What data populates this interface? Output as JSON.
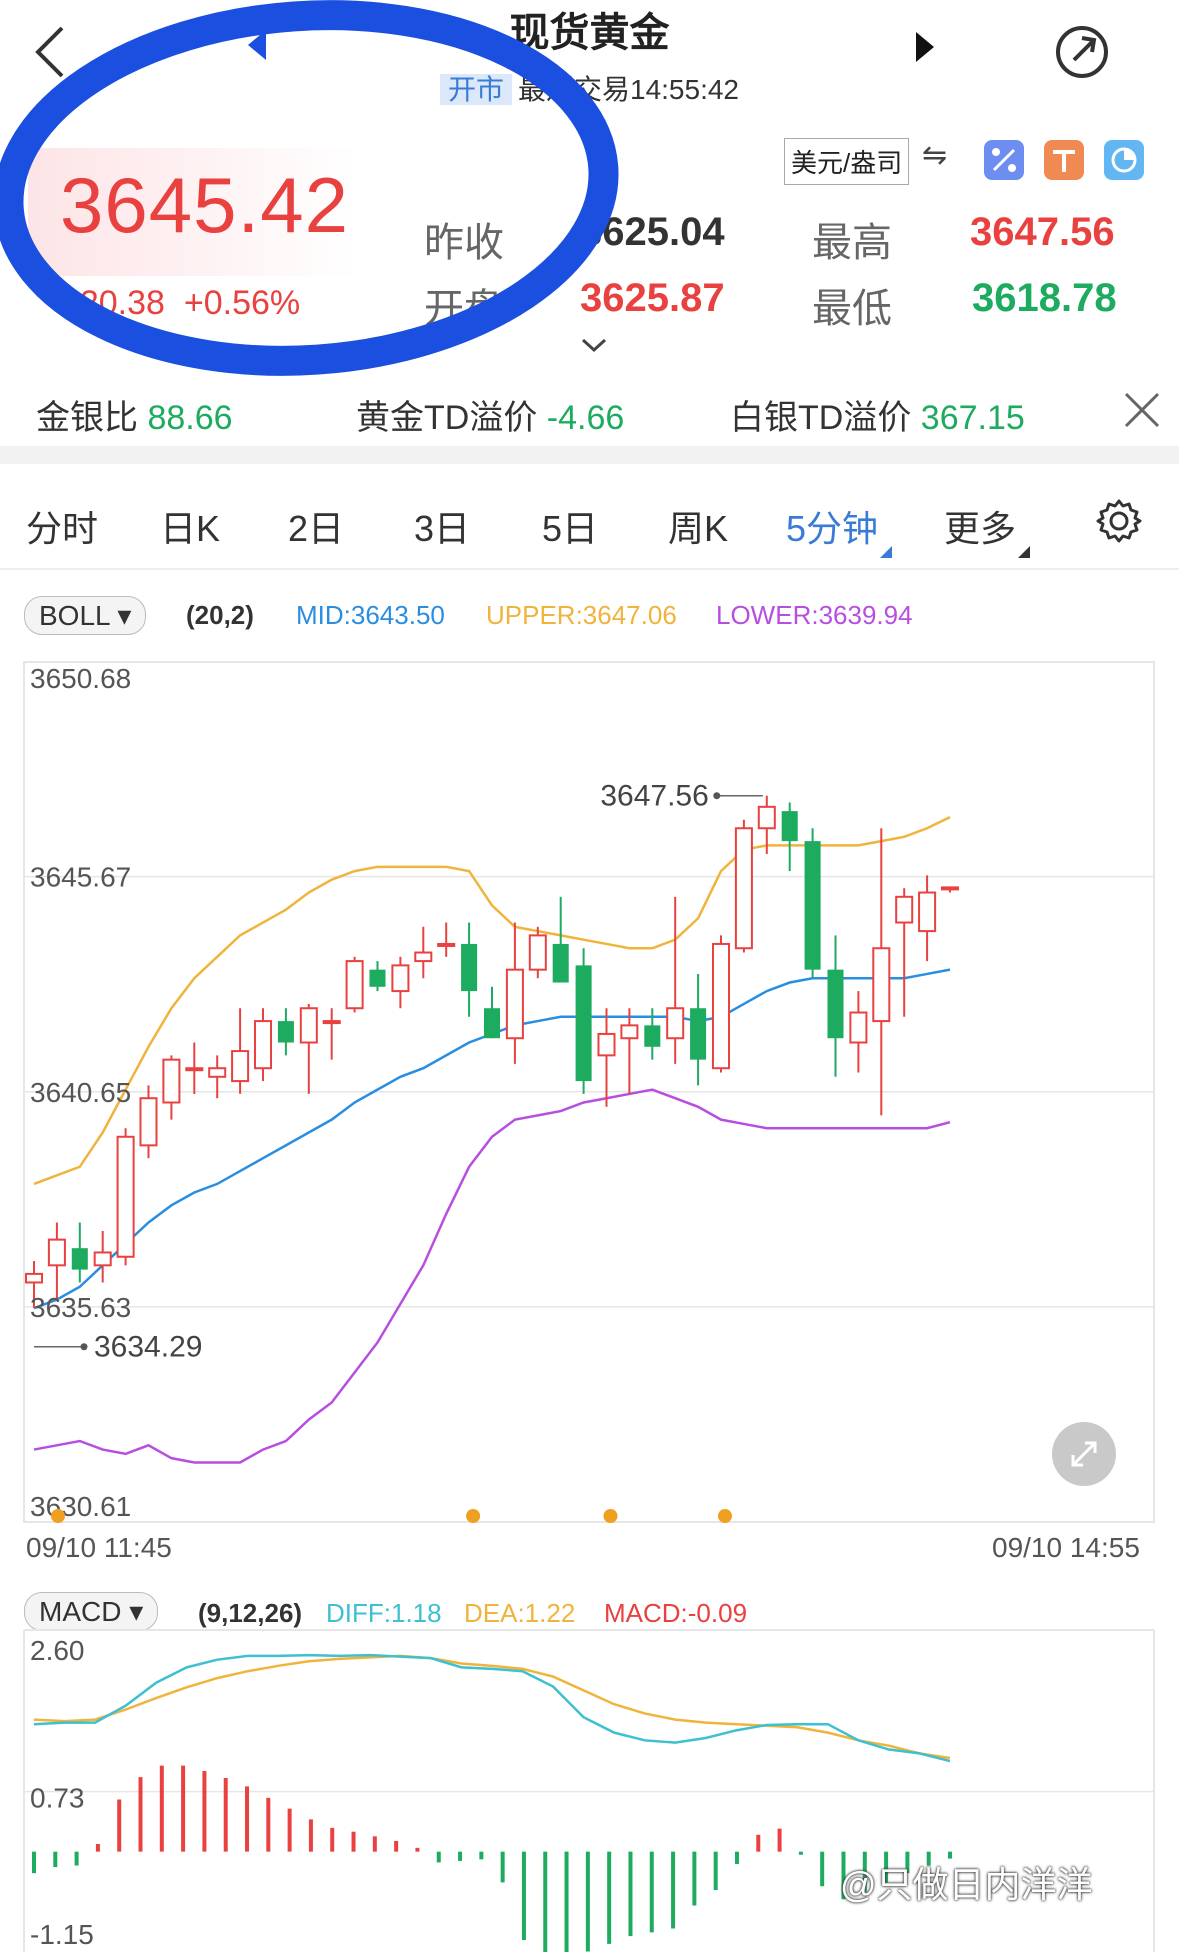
{
  "header": {
    "title": "现货黄金",
    "status_badge": "开市",
    "last_trade": "最近交易14:55:42"
  },
  "quote": {
    "price": "3645.42",
    "change": "+20.38",
    "change_pct": "+0.56%",
    "unit": "美元/盎司",
    "prev_close_label": "昨收",
    "prev_close": "3625.04",
    "open_label": "开盘",
    "open": "3625.87",
    "high_label": "最高",
    "high": "3647.56",
    "low_label": "最低",
    "low": "3618.78"
  },
  "ratio_bar": {
    "gs_label": "金银比",
    "gs_value": "88.66",
    "gold_td_label": "黄金TD溢价",
    "gold_td_value": "-4.66",
    "silver_td_label": "白银TD溢价",
    "silver_td_value": "367.15"
  },
  "tabs": [
    {
      "label": "分时"
    },
    {
      "label": "日K"
    },
    {
      "label": "2日"
    },
    {
      "label": "3日"
    },
    {
      "label": "5日"
    },
    {
      "label": "周K"
    },
    {
      "label": "5分钟"
    },
    {
      "label": "更多"
    }
  ],
  "boll": {
    "name": "BOLL",
    "params": "(20,2)",
    "mid": "MID:3643.50",
    "upper": "UPPER:3647.06",
    "lower": "LOWER:3639.94"
  },
  "macd": {
    "name": "MACD",
    "params": "(9,12,26)",
    "diff": "DIFF:1.18",
    "dea": "DEA:1.22",
    "macd": "MACD:-0.09"
  },
  "time_axis": {
    "start": "09/10 11:45",
    "end": "09/10 14:55"
  },
  "watermark": "@只做日内洋洋",
  "colors": {
    "up": "#e8413f",
    "down": "#1dab5f",
    "mid": "#2a8ee0",
    "upper": "#f0b43c",
    "lower": "#b84ee0",
    "accent": "#3a7bd5",
    "circle": "#1a4fe0"
  },
  "chart_data": [
    {
      "type": "candlestick",
      "title": "",
      "ylim": [
        3630.61,
        3650.68
      ],
      "yticks": [
        "3650.68",
        "3645.67",
        "3640.65",
        "3635.63",
        "3630.61"
      ],
      "max_label": "3647.56",
      "min_label": "3634.29",
      "candles": [
        [
          3636.2,
          3636.7,
          3635.6,
          3636.4
        ],
        [
          3636.6,
          3637.6,
          3635.8,
          3637.2
        ],
        [
          3637.0,
          3637.6,
          3636.2,
          3636.5
        ],
        [
          3636.6,
          3637.4,
          3636.2,
          3636.9
        ],
        [
          3636.8,
          3639.8,
          3636.6,
          3639.6
        ],
        [
          3639.4,
          3640.8,
          3639.1,
          3640.5
        ],
        [
          3640.4,
          3641.5,
          3640.0,
          3641.4
        ],
        [
          3641.2,
          3641.8,
          3640.6,
          3641.2
        ],
        [
          3641.0,
          3641.5,
          3640.5,
          3641.2
        ],
        [
          3640.9,
          3642.6,
          3640.6,
          3641.6
        ],
        [
          3641.2,
          3642.6,
          3640.9,
          3642.3
        ],
        [
          3642.3,
          3642.6,
          3641.5,
          3641.8
        ],
        [
          3641.8,
          3642.7,
          3640.6,
          3642.6
        ],
        [
          3642.3,
          3642.6,
          3641.4,
          3642.3
        ],
        [
          3642.6,
          3643.8,
          3642.5,
          3643.7
        ],
        [
          3643.5,
          3643.7,
          3643.0,
          3643.1
        ],
        [
          3643.0,
          3643.8,
          3642.6,
          3643.6
        ],
        [
          3643.7,
          3644.5,
          3643.3,
          3643.9
        ],
        [
          3644.1,
          3644.6,
          3643.8,
          3644.1
        ],
        [
          3644.1,
          3644.6,
          3642.4,
          3643.0
        ],
        [
          3642.6,
          3643.1,
          3641.9,
          3641.9
        ],
        [
          3641.9,
          3644.6,
          3641.3,
          3643.5
        ],
        [
          3643.5,
          3644.5,
          3643.3,
          3644.3
        ],
        [
          3644.1,
          3645.2,
          3643.9,
          3643.2
        ],
        [
          3643.6,
          3644.0,
          3640.6,
          3640.9
        ],
        [
          3641.5,
          3642.6,
          3640.3,
          3642.0
        ],
        [
          3641.9,
          3642.6,
          3640.6,
          3642.2
        ],
        [
          3642.2,
          3642.6,
          3641.4,
          3641.7
        ],
        [
          3641.9,
          3645.2,
          3641.3,
          3642.6
        ],
        [
          3642.6,
          3643.4,
          3640.8,
          3641.4
        ],
        [
          3641.2,
          3644.3,
          3641.1,
          3644.1
        ],
        [
          3644.0,
          3647.0,
          3643.9,
          3646.8
        ],
        [
          3646.8,
          3647.56,
          3646.2,
          3647.3
        ],
        [
          3647.2,
          3647.4,
          3645.8,
          3646.5
        ],
        [
          3646.5,
          3646.8,
          3643.3,
          3643.5
        ],
        [
          3643.5,
          3644.3,
          3641.0,
          3641.9
        ],
        [
          3641.8,
          3643.0,
          3641.1,
          3642.5
        ],
        [
          3642.3,
          3646.8,
          3640.1,
          3644.0
        ],
        [
          3644.6,
          3645.4,
          3642.4,
          3645.2
        ],
        [
          3644.4,
          3645.7,
          3643.7,
          3645.3
        ],
        [
          3645.4,
          3645.4,
          3645.3,
          3645.42
        ]
      ],
      "mid": [
        3635.6,
        3635.8,
        3636.1,
        3636.6,
        3637.1,
        3637.6,
        3638.0,
        3638.3,
        3638.5,
        3638.8,
        3639.1,
        3639.4,
        3639.7,
        3640.0,
        3640.4,
        3640.7,
        3641.0,
        3641.2,
        3641.5,
        3641.8,
        3642.0,
        3642.2,
        3642.3,
        3642.4,
        3642.4,
        3642.4,
        3642.4,
        3642.4,
        3642.4,
        3642.3,
        3642.4,
        3642.7,
        3643.0,
        3643.2,
        3643.3,
        3643.3,
        3643.3,
        3643.3,
        3643.3,
        3643.4,
        3643.5
      ],
      "upper": [
        3638.5,
        3638.7,
        3638.9,
        3639.7,
        3640.7,
        3641.7,
        3642.6,
        3643.3,
        3643.8,
        3644.3,
        3644.6,
        3644.9,
        3645.3,
        3645.6,
        3645.8,
        3645.9,
        3645.9,
        3645.9,
        3645.9,
        3645.8,
        3645.0,
        3644.5,
        3644.4,
        3644.3,
        3644.2,
        3644.1,
        3644.0,
        3644.0,
        3644.2,
        3644.7,
        3645.8,
        3646.3,
        3646.4,
        3646.4,
        3646.4,
        3646.4,
        3646.4,
        3646.5,
        3646.6,
        3646.8,
        3647.06
      ],
      "lower": [
        3632.3,
        3632.4,
        3632.5,
        3632.3,
        3632.2,
        3632.4,
        3632.1,
        3632.0,
        3632.0,
        3632.0,
        3632.3,
        3632.5,
        3633.0,
        3633.4,
        3634.1,
        3634.8,
        3635.7,
        3636.6,
        3637.8,
        3638.9,
        3639.6,
        3640.0,
        3640.1,
        3640.2,
        3640.4,
        3640.5,
        3640.6,
        3640.7,
        3640.5,
        3640.3,
        3640.0,
        3639.9,
        3639.8,
        3639.8,
        3639.8,
        3639.8,
        3639.8,
        3639.8,
        3639.8,
        3639.8,
        3639.94
      ]
    },
    {
      "type": "macd",
      "title": "",
      "yticks": [
        "2.60",
        "0.73",
        "-1.15"
      ],
      "ylim": [
        -1.15,
        2.6
      ],
      "diff": [
        1.66,
        1.68,
        1.68,
        1.9,
        2.2,
        2.4,
        2.5,
        2.55,
        2.55,
        2.56,
        2.55,
        2.56,
        2.54,
        2.52,
        2.4,
        2.38,
        2.35,
        2.15,
        1.75,
        1.55,
        1.45,
        1.42,
        1.48,
        1.58,
        1.65,
        1.66,
        1.66,
        1.45,
        1.33,
        1.28,
        1.18
      ],
      "dea": [
        1.72,
        1.7,
        1.72,
        1.85,
        2.0,
        2.14,
        2.26,
        2.35,
        2.42,
        2.48,
        2.51,
        2.53,
        2.55,
        2.52,
        2.45,
        2.42,
        2.38,
        2.28,
        2.1,
        1.92,
        1.8,
        1.72,
        1.68,
        1.66,
        1.64,
        1.62,
        1.55,
        1.45,
        1.38,
        1.28,
        1.22
      ],
      "hist": [
        -0.28,
        -0.2,
        -0.18,
        0.1,
        0.68,
        0.97,
        1.12,
        1.12,
        1.05,
        0.96,
        0.85,
        0.7,
        0.56,
        0.42,
        0.31,
        0.26,
        0.2,
        0.14,
        0.05,
        -0.14,
        -0.12,
        -0.1,
        -0.4,
        -1.15,
        -1.35,
        -1.4,
        -1.3,
        -1.2,
        -1.1,
        -1.05,
        -1.0,
        -0.7,
        -0.5,
        -0.16,
        0.22,
        0.3,
        -0.04,
        -0.45,
        -0.62,
        -0.52,
        -0.4,
        -0.28,
        -0.18,
        -0.09
      ]
    }
  ]
}
